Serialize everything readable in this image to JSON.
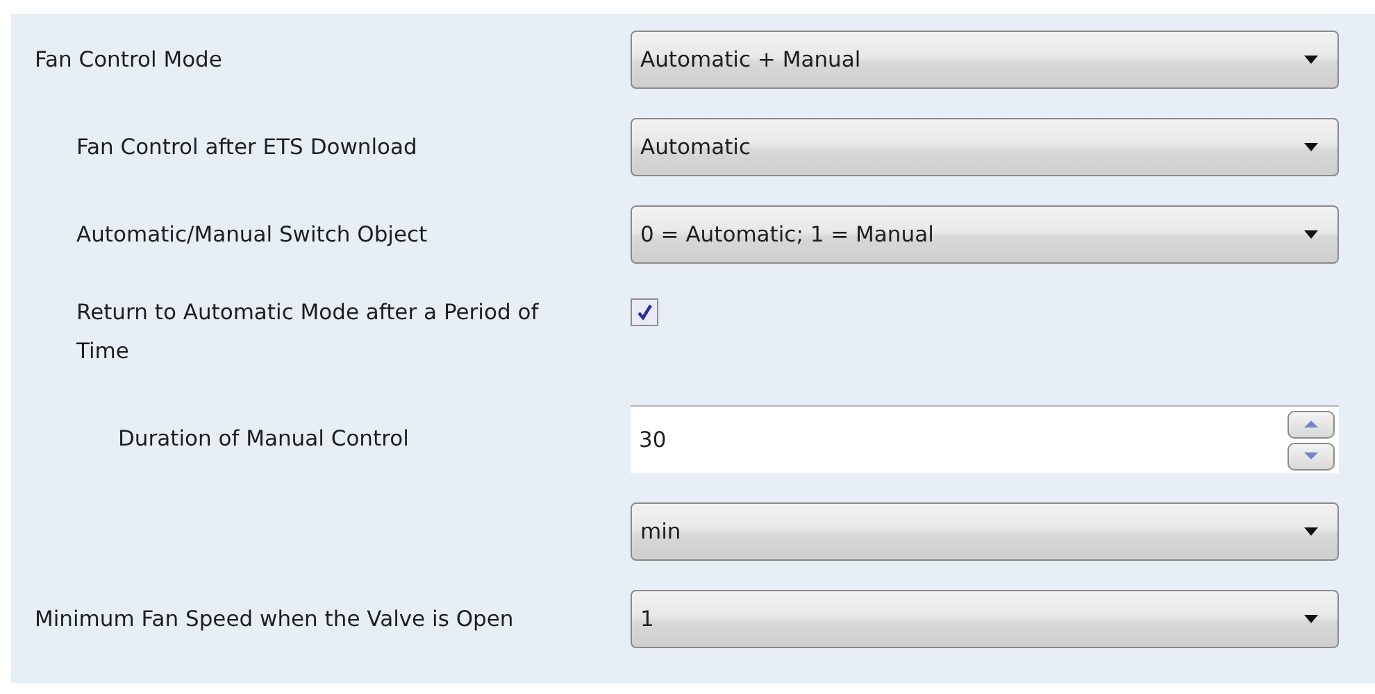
{
  "parameters": [
    {
      "kind": "dropdown",
      "label": "Fan Control Mode",
      "value": "Automatic + Manual",
      "children": [
        {
          "kind": "dropdown",
          "label": "Fan Control after ETS Download",
          "value": "Automatic"
        },
        {
          "kind": "dropdown",
          "label": "Automatic/Manual Switch Object",
          "value": "0 = Automatic; 1 = Manual"
        },
        {
          "kind": "checkbox",
          "label": "Return to Automatic Mode after a Period of Time",
          "checked": true,
          "children": [
            {
              "kind": "spin",
              "label": "Duration of Manual Control",
              "value": "30",
              "unit": "min"
            }
          ]
        }
      ]
    },
    {
      "kind": "dropdown",
      "label": "Minimum Fan Speed when the Valve is Open",
      "value": "1"
    }
  ]
}
